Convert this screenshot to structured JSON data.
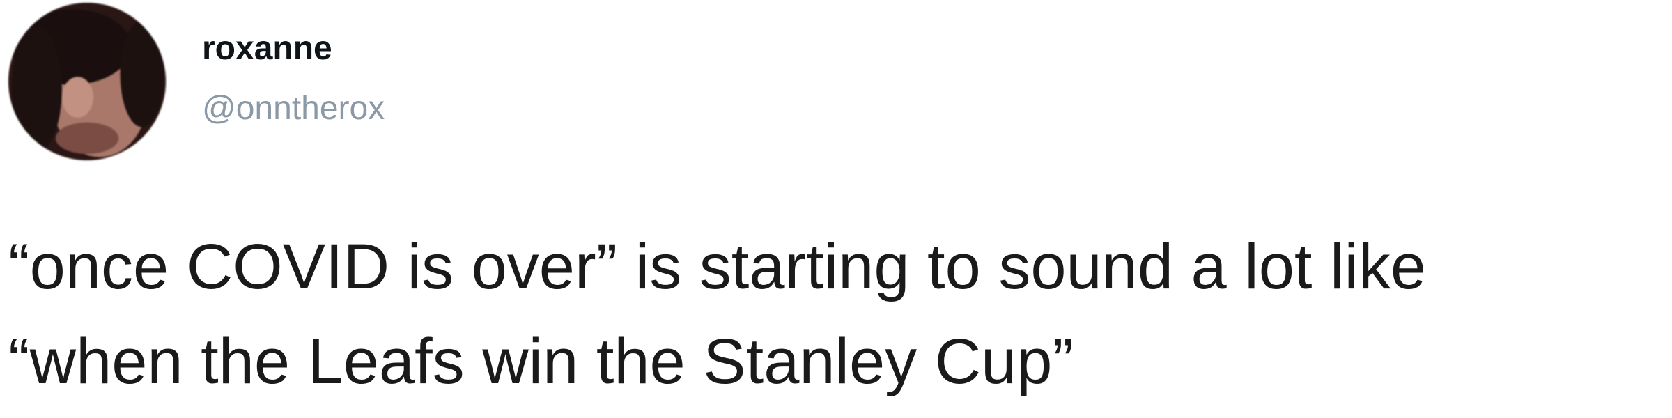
{
  "tweet": {
    "display_name": "roxanne",
    "handle": "@onntherox",
    "text_lines": [
      "“once COVID is over” is starting to sound a lot like",
      "“when the Leafs win the Stanley Cup”"
    ]
  }
}
